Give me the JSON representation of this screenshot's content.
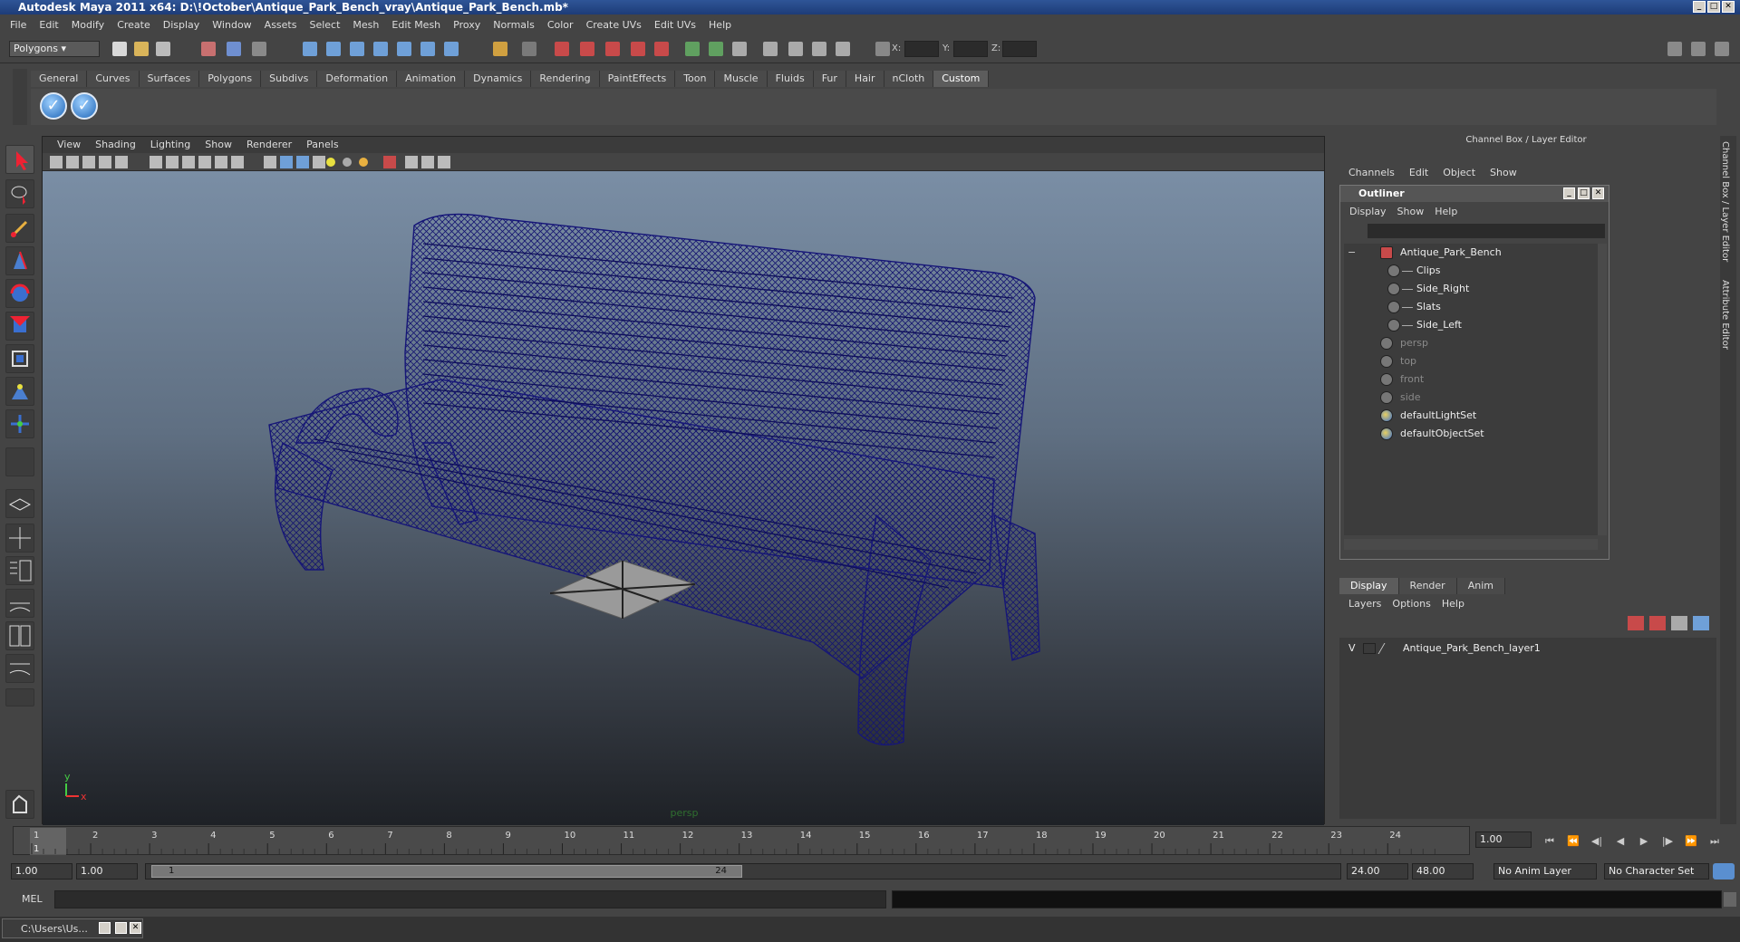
{
  "window": {
    "title": "Autodesk Maya 2011 x64: D:\\!October\\Antique_Park_Bench_vray\\Antique_Park_Bench.mb*"
  },
  "menubar": [
    "File",
    "Edit",
    "Modify",
    "Create",
    "Display",
    "Window",
    "Assets",
    "Select",
    "Mesh",
    "Edit Mesh",
    "Proxy",
    "Normals",
    "Color",
    "Create UVs",
    "Edit UVs",
    "Help"
  ],
  "status_line": {
    "mode": "Polygons",
    "x_label": "X:",
    "y_label": "Y:",
    "z_label": "Z:"
  },
  "shelf": {
    "tabs": [
      "General",
      "Curves",
      "Surfaces",
      "Polygons",
      "Subdivs",
      "Deformation",
      "Animation",
      "Dynamics",
      "Rendering",
      "PaintEffects",
      "Toon",
      "Muscle",
      "Fluids",
      "Fur",
      "Hair",
      "nCloth",
      "Custom"
    ],
    "active_tab": "Custom"
  },
  "viewport": {
    "menu": [
      "View",
      "Shading",
      "Lighting",
      "Show",
      "Renderer",
      "Panels"
    ],
    "camera_label": "persp",
    "axis_x": "x",
    "axis_y": "y"
  },
  "channel_box": {
    "title": "Channel Box / Layer Editor",
    "menu": [
      "Channels",
      "Edit",
      "Object",
      "Show"
    ],
    "side_tabs": [
      "Channel Box / Layer Editor",
      "Attribute Editor"
    ]
  },
  "outliner": {
    "title": "Outliner",
    "menu": [
      "Display",
      "Show",
      "Help"
    ],
    "items": [
      {
        "label": "Antique_Park_Bench",
        "depth": 0,
        "dim": false
      },
      {
        "label": "Clips",
        "depth": 1,
        "dim": false
      },
      {
        "label": "Side_Right",
        "depth": 1,
        "dim": false
      },
      {
        "label": "Slats",
        "depth": 1,
        "dim": false
      },
      {
        "label": "Side_Left",
        "depth": 1,
        "dim": false
      },
      {
        "label": "persp",
        "depth": 0,
        "dim": true
      },
      {
        "label": "top",
        "depth": 0,
        "dim": true
      },
      {
        "label": "front",
        "depth": 0,
        "dim": true
      },
      {
        "label": "side",
        "depth": 0,
        "dim": true
      },
      {
        "label": "defaultLightSet",
        "depth": 0,
        "dim": false
      },
      {
        "label": "defaultObjectSet",
        "depth": 0,
        "dim": false
      }
    ]
  },
  "layer_editor": {
    "tabs": [
      "Display",
      "Render",
      "Anim"
    ],
    "active_tab": "Display",
    "menu": [
      "Layers",
      "Options",
      "Help"
    ],
    "layers": [
      {
        "visible": "V",
        "name": "Antique_Park_Bench_layer1"
      }
    ]
  },
  "time_slider": {
    "ticks": [
      "1",
      "2",
      "3",
      "4",
      "5",
      "6",
      "7",
      "8",
      "9",
      "10",
      "11",
      "12",
      "13",
      "14",
      "15",
      "16",
      "17",
      "18",
      "19",
      "20",
      "21",
      "22",
      "23",
      "24"
    ],
    "current_frame_marker": "1",
    "current_time": "1.00"
  },
  "range_slider": {
    "start_time": "1.00",
    "playback_start": "1.00",
    "range_start_label": "1",
    "range_end_label": "24",
    "playback_end": "24.00",
    "end_time": "48.00",
    "anim_layer": "No Anim Layer",
    "character_set": "No Character Set"
  },
  "command_line": {
    "label": "MEL"
  },
  "taskbar": {
    "item": "C:\\Users\\Us..."
  }
}
